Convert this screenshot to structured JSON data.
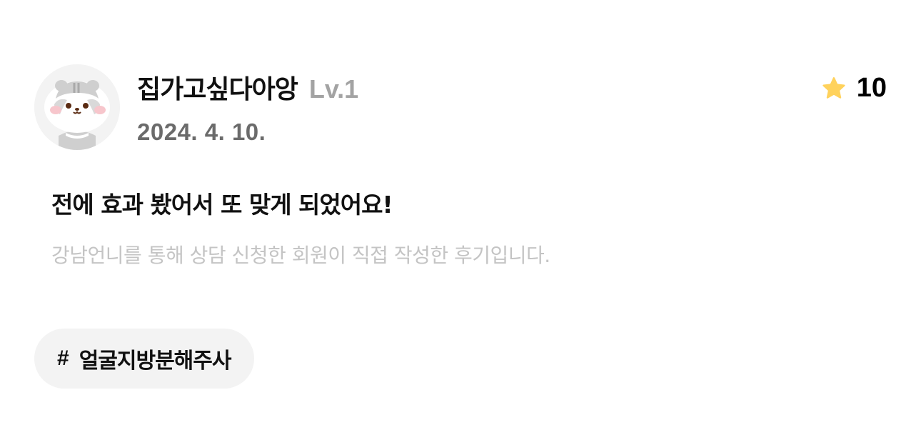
{
  "review": {
    "author": {
      "name": "집가고싶다아앙",
      "level": "Lv.1",
      "avatar_icon": "hamster-avatar-icon"
    },
    "date": "2024. 4. 10.",
    "rating": {
      "icon": "star-icon",
      "icon_color": "#FFD25C",
      "value": "10"
    },
    "title": "전에 효과 봤어서 또 맞게 되었어요!",
    "disclaimer": "강남언니를 통해 상담 신청한 회원이 직접 작성한 후기입니다.",
    "tags": [
      {
        "hash": "#",
        "label": "얼굴지방분해주사"
      }
    ]
  }
}
